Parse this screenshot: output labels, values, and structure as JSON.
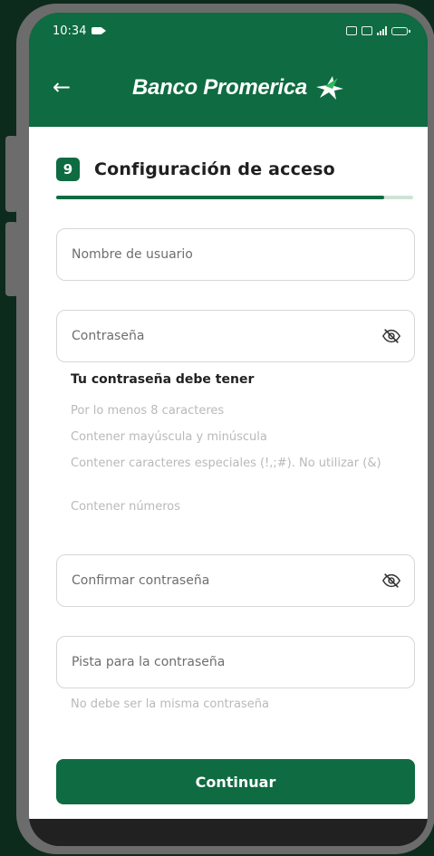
{
  "status_bar": {
    "time": "10:34"
  },
  "header": {
    "brand": "Banco Promerica",
    "back_label": "←"
  },
  "step": {
    "number": "9",
    "title": "Configuración de acceso",
    "progress": 0.92
  },
  "form": {
    "username_placeholder": "Nombre de usuario",
    "password_placeholder": "Contraseña",
    "confirm_placeholder": "Confirmar contraseña",
    "hint_placeholder": "Pista para la contraseña"
  },
  "password_rules": {
    "title": "Tu contraseña debe tener",
    "items": [
      "Por lo menos 8 caracteres",
      "Contener mayúscula y minúscula",
      "Contener caracteres especiales (!,;#). No utilizar (&)",
      "Contener números"
    ]
  },
  "hint_note": "No debe ser la misma contraseña",
  "continue_label": "Continuar",
  "colors": {
    "brand_green": "#0f6b41",
    "accent_green": "#2fb85a"
  }
}
